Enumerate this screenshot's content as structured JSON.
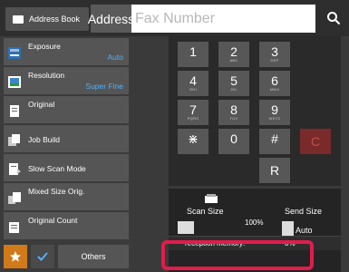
{
  "topbar": {
    "address_book_label": "Address Book",
    "address_label": "Address",
    "fax_placeholder": "Fax Number"
  },
  "menu": [
    {
      "label": "Exposure",
      "value": "Auto"
    },
    {
      "label": "Resolution",
      "value": "Super Fine"
    },
    {
      "label": "Original",
      "value": ""
    },
    {
      "label": "Job Build",
      "value": ""
    },
    {
      "label": "Slow Scan Mode",
      "value": ""
    },
    {
      "label": "Mixed Size Orig.",
      "value": ""
    },
    {
      "label": "Original Count",
      "value": ""
    }
  ],
  "bottom": {
    "others_label": "Others"
  },
  "keypad": {
    "keys": [
      {
        "n": "1",
        "s": ""
      },
      {
        "n": "2",
        "s": "ABC"
      },
      {
        "n": "3",
        "s": "DEF"
      },
      {
        "n": "4",
        "s": "GHI"
      },
      {
        "n": "5",
        "s": "JKL"
      },
      {
        "n": "6",
        "s": "MNO"
      },
      {
        "n": "7",
        "s": "PQRS"
      },
      {
        "n": "8",
        "s": "TUV"
      },
      {
        "n": "9",
        "s": "WXYZ"
      },
      {
        "n": "⋇",
        "s": ""
      },
      {
        "n": "0",
        "s": ""
      },
      {
        "n": "#",
        "s": ""
      },
      {
        "n": "C",
        "s": ""
      },
      {
        "n": "R",
        "s": ""
      }
    ]
  },
  "status": {
    "scan_size_label": "Scan Size",
    "send_size_label": "Send Size",
    "ratio": "100%",
    "send_size_value": "Auto",
    "memory_label": "reception memory:",
    "memory_value": "0%"
  },
  "colors": {
    "highlight": "#e41b4c",
    "accent": "#4fb0ff",
    "favorite": "#d07a1a"
  }
}
